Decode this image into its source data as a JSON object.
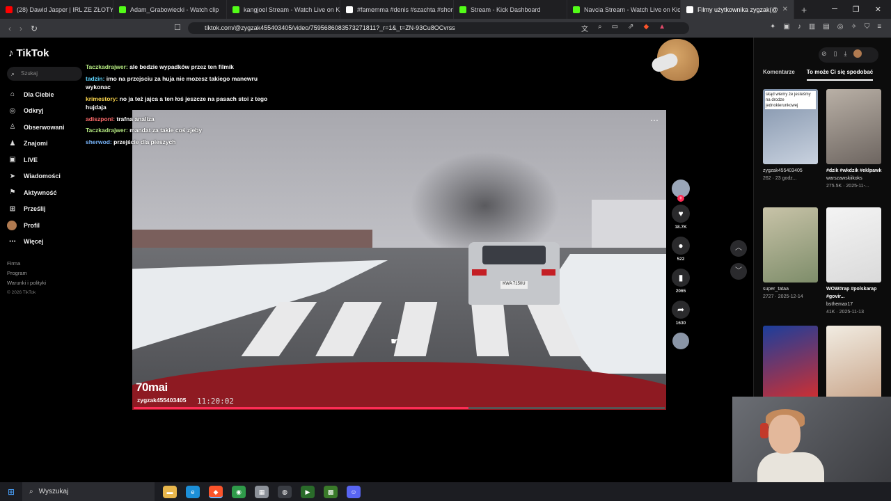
{
  "browser": {
    "tabs": [
      {
        "label": "(28) Dawid Jasper | IRL ZE ZŁOTYCH",
        "favicon": "youtube-icon",
        "color": "#ff0000"
      },
      {
        "label": "Adam_Grabowiecki - Watch clip",
        "favicon": "kick-icon",
        "color": "#53fc18"
      },
      {
        "label": "kangjoel Stream - Watch Live on Kick",
        "favicon": "kick-icon",
        "color": "#53fc18"
      },
      {
        "label": "#famemma #denis #szachta #short",
        "favicon": "tiktok-icon",
        "color": "#ffffff"
      },
      {
        "label": "Stream - Kick Dashboard",
        "favicon": "kick-icon",
        "color": "#53fc18"
      },
      {
        "label": "Navcia Stream - Watch Live on Kick",
        "favicon": "kick-icon",
        "color": "#53fc18"
      },
      {
        "label": "Filmy użytkownika zygzak(@",
        "favicon": "tiktok-icon",
        "color": "#ffffff",
        "active": true
      }
    ],
    "url": "tiktok.com/@zygzak455403405/video/7595686083573271811?_r=1&_t=ZN-93Cu8OCvrss"
  },
  "sidebar": {
    "logo": "TikTok",
    "search_placeholder": "Szukaj",
    "items": [
      {
        "label": "Dla Ciebie",
        "icon": "home-icon"
      },
      {
        "label": "Odkryj",
        "icon": "compass-icon"
      },
      {
        "label": "Obserwowani",
        "icon": "user-follow-icon"
      },
      {
        "label": "Znajomi",
        "icon": "friends-icon"
      },
      {
        "label": "LIVE",
        "icon": "live-icon"
      },
      {
        "label": "Wiadomości",
        "icon": "send-icon"
      },
      {
        "label": "Aktywność",
        "icon": "activity-icon"
      },
      {
        "label": "Prześlij",
        "icon": "upload-icon"
      },
      {
        "label": "Profil",
        "icon": "profile-avatar-icon"
      },
      {
        "label": "Więcej",
        "icon": "more-dots-icon"
      }
    ],
    "footer": [
      "Firma",
      "Program",
      "Warunki i polityki"
    ],
    "copyright": "© 2026 TikTok"
  },
  "chat": [
    {
      "user": "Taczkadrajwer",
      "text": "ale bedzie wypadków przez ten filmik",
      "cls": "u1"
    },
    {
      "user": "tadzin",
      "text": "imo na przejsciu za huja nie mozesz takiego manewru wykonac",
      "cls": "u2"
    },
    {
      "user": "krimestory",
      "text": "no ja też jajca a ten łoś jeszcze na pasach stoi z tego hujdaja",
      "cls": "u3"
    },
    {
      "user": "adiszponi",
      "text": "trafna analiza",
      "cls": "u4"
    },
    {
      "user": "Taczkadrajwer",
      "text": "mandat za takie coś zjeby",
      "cls": "u1"
    },
    {
      "user": "sherwod",
      "text": "przejście dla pieszych",
      "cls": "u5"
    }
  ],
  "video": {
    "brand": "70mai",
    "username": "zygzak455403405",
    "timestamp": "11:20:02",
    "plate": "KWA 7150U",
    "progress": 0.63
  },
  "actions": {
    "likes": "18.7K",
    "comments": "522",
    "saves": "2065",
    "shares": "1630"
  },
  "right_panel": {
    "tabs": [
      "Komentarze",
      "To może Ci się spodobać"
    ],
    "active_tab": 1,
    "videos": [
      {
        "overlay": "skąd wiemy że jesteśmy na drodze jednokierunkowej",
        "author": "zygzak455403405",
        "stats": "262 · 23 godz...",
        "title": "",
        "colors": [
          "#7d8fa8",
          "#c9d2df"
        ]
      },
      {
        "overlay": "",
        "author": "warszawskiikoks",
        "stats": "275.5K · 2025-11-...",
        "title": "#dzik #wkdzik #eklpawk",
        "colors": [
          "#b9b0a6",
          "#6d6560"
        ]
      },
      {
        "overlay": "",
        "author": "super_tataa",
        "stats": "2727 · 2025-12-14",
        "title": "",
        "colors": [
          "#c8c3a8",
          "#7e8d6a"
        ]
      },
      {
        "overlay": "",
        "author": "bsthemax17",
        "stats": "41K · 2025-11-13",
        "title": "WOW#rap #polskarap #govir...",
        "colors": [
          "#f4f4f4",
          "#dadada"
        ]
      },
      {
        "overlay": "",
        "author": "",
        "stats": "",
        "title": "",
        "colors": [
          "#1b3e9c",
          "#d32f2f"
        ]
      },
      {
        "overlay": "",
        "author": "",
        "stats": "",
        "title": "",
        "colors": [
          "#f1ece2",
          "#c9a58a"
        ]
      }
    ]
  },
  "taskbar": {
    "search_label": "Wyszukaj"
  }
}
